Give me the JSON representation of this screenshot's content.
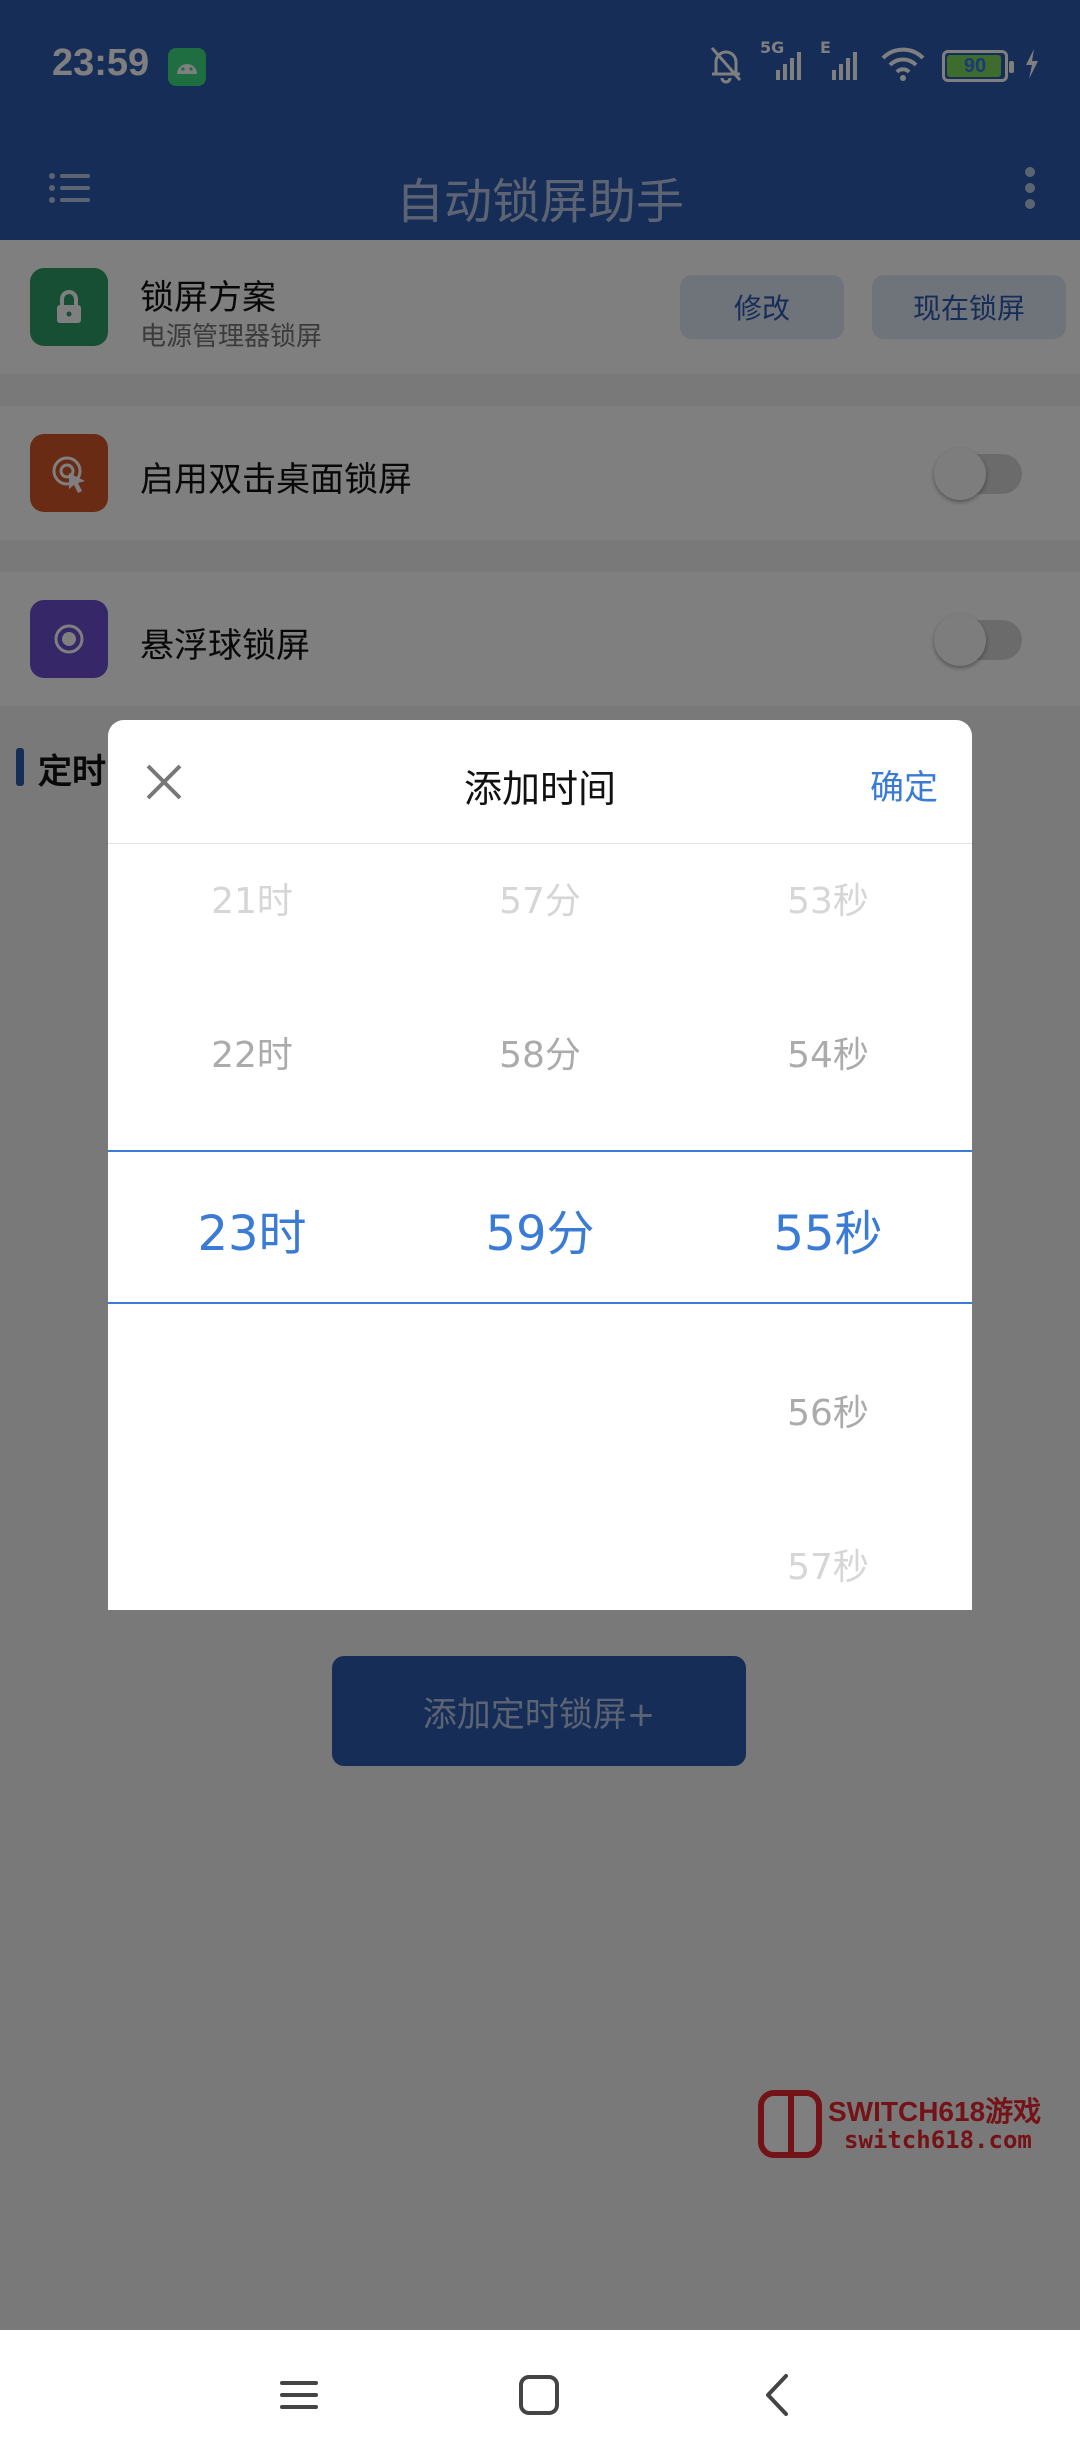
{
  "status_bar": {
    "time": "23:59",
    "battery_level": "90",
    "network": "5G",
    "network2": "E"
  },
  "app_bar": {
    "title": "自动锁屏助手"
  },
  "lock_plan": {
    "title": "锁屏方案",
    "subtitle": "电源管理器锁屏",
    "edit_label": "修改",
    "lock_now_label": "现在锁屏"
  },
  "double_tap": {
    "label": "启用双击桌面锁屏",
    "enabled": false
  },
  "float_ball": {
    "label": "悬浮球锁屏",
    "enabled": false
  },
  "timed_section": {
    "label": "定时"
  },
  "add_button": {
    "label": "添加定时锁屏+"
  },
  "watermark": {
    "line1": "SWITCH618游戏",
    "line2": "switch618.com"
  },
  "dialog": {
    "title": "添加时间",
    "confirm_label": "确定",
    "hours": {
      "far_above": "21时",
      "near_above": "22时",
      "selected": "23时"
    },
    "minutes": {
      "far_above": "57分",
      "near_above": "58分",
      "selected": "59分"
    },
    "seconds": {
      "far_above": "53秒",
      "near_above": "54秒",
      "selected": "55秒",
      "near_below": "56秒",
      "far_below": "57秒"
    }
  },
  "colors": {
    "primary": "#2d5bb1",
    "accent": "#3a7bd5",
    "lock_icon_bg": "#2e9e6b",
    "tap_icon_bg": "#d4572b",
    "float_icon_bg": "#6a4fd1"
  }
}
